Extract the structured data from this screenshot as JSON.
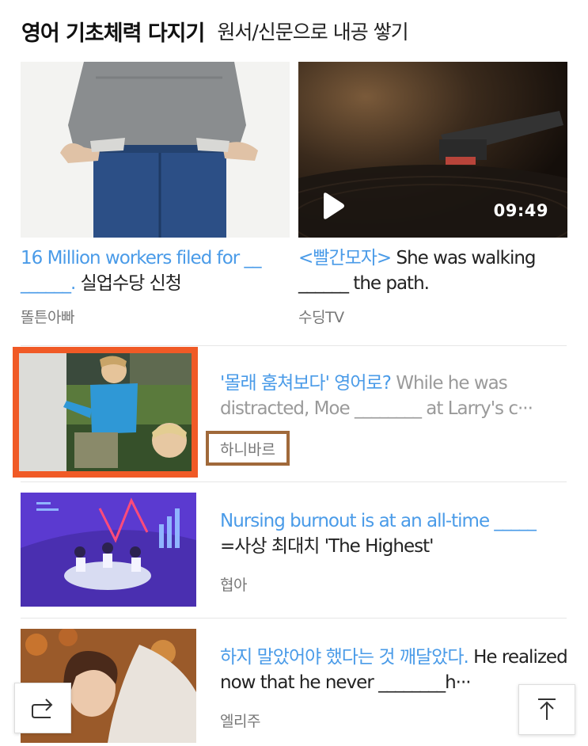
{
  "header": {
    "title": "영어 기초체력 다지기",
    "subtitle": "원서/신문으로 내공 쌓기"
  },
  "cards": [
    {
      "title_highlight": "16 Million workers filed for __ ______.",
      "title_rest": " 실업수당 신청",
      "source": "똘튼아빠"
    },
    {
      "title_highlight": "<빨간모자>",
      "title_rest": " She was walking ______ the path.",
      "source": "수딩TV",
      "duration": "09:49"
    }
  ],
  "list": [
    {
      "title_highlight": "'몰래 훔쳐보다' 영어로?",
      "title_rest_gray": " While he was distracted, Moe ________ at Larry's c···",
      "source": "하니바르"
    },
    {
      "title_highlight": "Nursing burnout is at an all-time _____",
      "title_rest": "=사상 최대치 'The Highest'",
      "source": "협아"
    },
    {
      "title_highlight": "하지 말았어야 했다는 것 깨달았다.",
      "title_rest": " He realized now that he never ________h···",
      "source": "엘리주"
    }
  ],
  "colors": {
    "highlight": "#4a9be8",
    "selected_border": "#f05a26",
    "source_border": "#a0693a"
  },
  "icons": {
    "share": "share-icon",
    "top": "arrow-up-icon",
    "play": "play-icon"
  }
}
